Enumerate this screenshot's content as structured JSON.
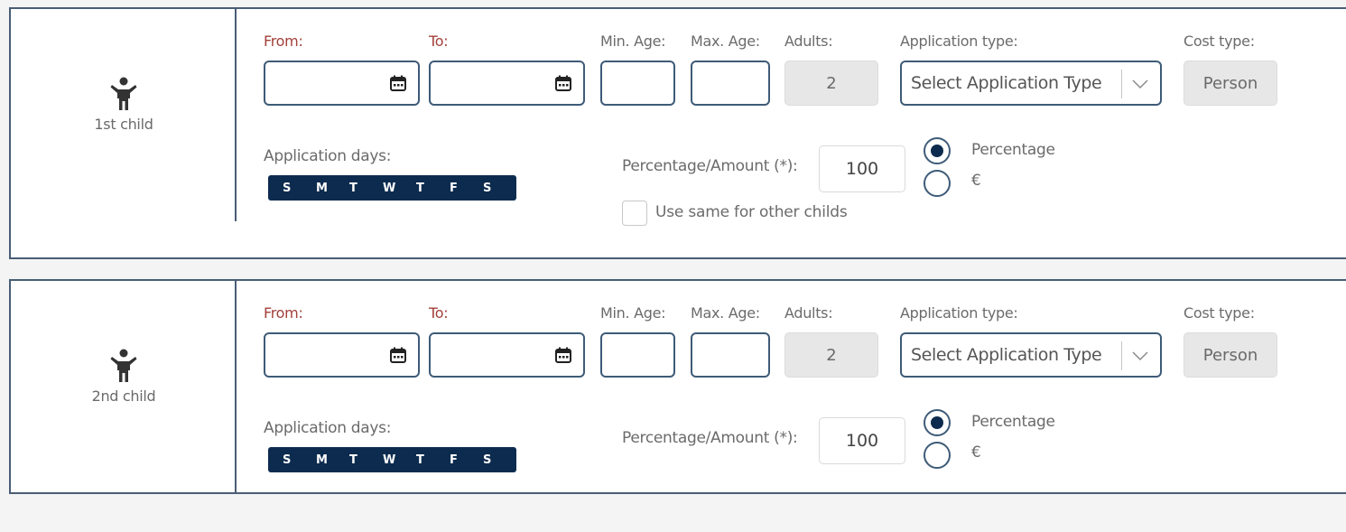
{
  "children": [
    {
      "label": "1st child",
      "icon": "child-icon",
      "from_label": "From:",
      "from_value": "",
      "to_label": "To:",
      "to_value": "",
      "min_age_label": "Min. Age:",
      "min_age_value": "",
      "max_age_label": "Max. Age:",
      "max_age_value": "",
      "adults_label": "Adults:",
      "adults_value": "2",
      "application_type_label": "Application type:",
      "application_type_value": "Select Application Type",
      "cost_type_label": "Cost type:",
      "cost_type_value": "Person",
      "application_days_label": "Application days:",
      "days": [
        "S",
        "M",
        "T",
        "W",
        "T",
        "F",
        "S"
      ],
      "percentage_amount_label": "Percentage/Amount (*):",
      "percentage_amount_value": "100",
      "radio_percentage_label": "Percentage",
      "radio_currency_label": "€",
      "selected_mode": "Percentage",
      "use_same_label": "Use same for other childs",
      "use_same_checked": false
    },
    {
      "label": "2nd child",
      "icon": "child-icon",
      "from_label": "From:",
      "from_value": "",
      "to_label": "To:",
      "to_value": "",
      "min_age_label": "Min. Age:",
      "min_age_value": "",
      "max_age_label": "Max. Age:",
      "max_age_value": "",
      "adults_label": "Adults:",
      "adults_value": "2",
      "application_type_label": "Application type:",
      "application_type_value": "Select Application Type",
      "cost_type_label": "Cost type:",
      "cost_type_value": "Person",
      "application_days_label": "Application days:",
      "days": [
        "S",
        "M",
        "T",
        "W",
        "T",
        "F",
        "S"
      ],
      "percentage_amount_label": "Percentage/Amount (*):",
      "percentage_amount_value": "100",
      "radio_percentage_label": "Percentage",
      "radio_currency_label": "€",
      "selected_mode": "Percentage"
    }
  ],
  "colors": {
    "primary": "#0d2b4e",
    "border": "#3e5b78",
    "required_label": "#a3403a",
    "disabled_bg": "#e7e7e7"
  }
}
